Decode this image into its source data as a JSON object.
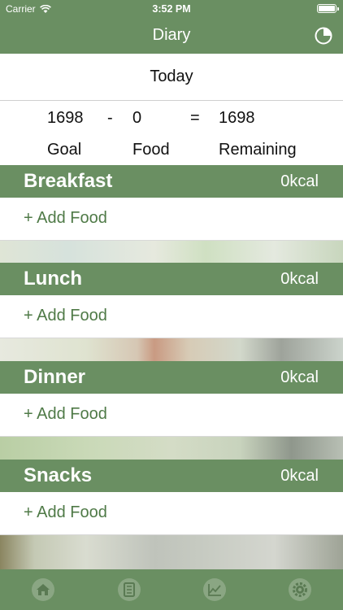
{
  "status_bar": {
    "carrier": "Carrier",
    "time": "3:52 PM"
  },
  "nav": {
    "title": "Diary",
    "right_icon": "pie-chart-icon"
  },
  "date": {
    "label": "Today"
  },
  "summary": {
    "goal_value": "1698",
    "minus": "-",
    "food_value": "0",
    "equals": "=",
    "remaining_value": "1698",
    "goal_label": "Goal",
    "food_label": "Food",
    "remaining_label": "Remaining"
  },
  "meals": [
    {
      "name": "Breakfast",
      "kcal": "0kcal",
      "add_label": "+ Add Food"
    },
    {
      "name": "Lunch",
      "kcal": "0kcal",
      "add_label": "+ Add Food"
    },
    {
      "name": "Dinner",
      "kcal": "0kcal",
      "add_label": "+ Add Food"
    },
    {
      "name": "Snacks",
      "kcal": "0kcal",
      "add_label": "+ Add Food"
    }
  ],
  "tabbar": {
    "icons": [
      "home-icon",
      "diary-icon",
      "chart-icon",
      "settings-icon"
    ]
  },
  "colors": {
    "accent": "#6a8f62",
    "add_text": "#4f7a47"
  }
}
